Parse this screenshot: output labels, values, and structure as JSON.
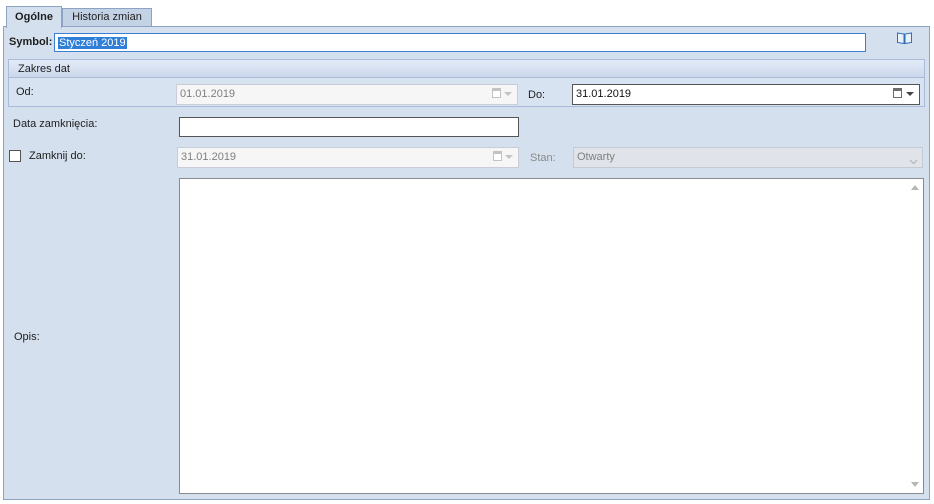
{
  "tabs": [
    {
      "label": "Ogólne",
      "active": true
    },
    {
      "label": "Historia zmian",
      "active": false
    }
  ],
  "symbol": {
    "label": "Symbol:",
    "value": "Styczeń 2019",
    "icon": "book-icon"
  },
  "zakres_dat": {
    "title": "Zakres dat",
    "od": {
      "label": "Od:",
      "value": "01.01.2019",
      "disabled": true
    },
    "do": {
      "label": "Do:",
      "value": "31.01.2019",
      "disabled": false
    }
  },
  "data_zamkniecia": {
    "label": "Data zamknięcia:",
    "value": ""
  },
  "zamknij_do": {
    "label": "Zamknij do:",
    "checked": false,
    "value": "31.01.2019",
    "disabled": true
  },
  "stan": {
    "label": "Stan:",
    "value": "Otwarty",
    "disabled": true
  },
  "opis": {
    "label": "Opis:",
    "value": ""
  },
  "colors": {
    "panel": "#d5e0ef",
    "selection": "#2f7fd8",
    "border": "#8da3c4"
  }
}
